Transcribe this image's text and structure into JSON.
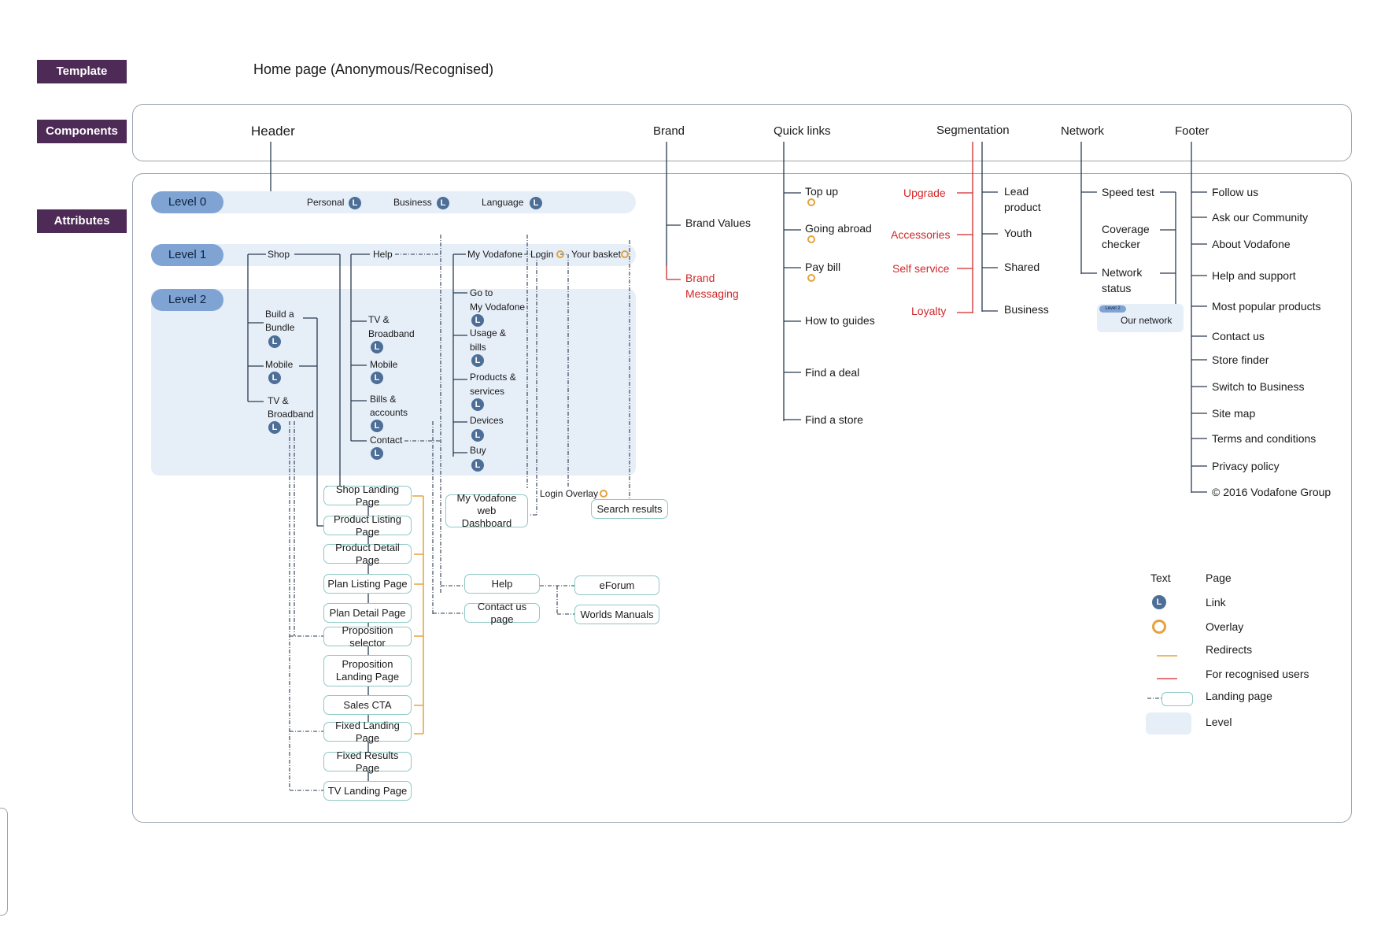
{
  "labels": {
    "template": "Template",
    "components": "Components",
    "attributes": "Attributes"
  },
  "page_title": "Home page (Anonymous/Recognised)",
  "components": {
    "header": "Header",
    "brand": "Brand",
    "quick_links": "Quick links",
    "segmentation": "Segmentation",
    "network": "Network",
    "footer": "Footer"
  },
  "levels": {
    "l0": "Level 0",
    "l1": "Level 1",
    "l2": "Level 2"
  },
  "level0": {
    "personal": "Personal",
    "business": "Business",
    "language": "Language"
  },
  "link_glyph": "L",
  "level1": {
    "shop": "Shop",
    "help": "Help",
    "my_vodafone": "My Vodafone",
    "login": "Login",
    "basket": "Your basket"
  },
  "shop_items": {
    "bundle_a": "Build a",
    "bundle_b": "Bundle",
    "mobile": "Mobile",
    "tv_a": "TV &",
    "tv_b": "Broadband"
  },
  "help_items": {
    "tv_a": "TV &",
    "tv_b": "Broadband",
    "mobile": "Mobile",
    "bills_a": "Bills &",
    "bills_b": "accounts",
    "contact": "Contact"
  },
  "myv_items": {
    "goto_a": "Go to",
    "goto_b": "My Vodafone",
    "usage_a": "Usage &",
    "usage_b": "bills",
    "prod_a": "Products &",
    "prod_b": "services",
    "devices": "Devices",
    "buy": "Buy"
  },
  "pages": {
    "shop_landing": "Shop Landing Page",
    "product_listing": "Product Listing Page",
    "product_detail": "Product Detail Page",
    "plan_listing": "Plan Listing Page",
    "plan_detail": "Plan Detail Page",
    "proposition_selector": "Proposition selector",
    "prop_landing_a": "Proposition",
    "prop_landing_b": "Landing Page",
    "sales_cta": "Sales CTA",
    "fixed_landing": "Fixed Landing Page",
    "fixed_results": "Fixed Results Page",
    "tv_landing": "TV Landing Page",
    "myv_dash_a": "My Vodafone web",
    "myv_dash_b": "Dashboard",
    "login_overlay": "Login Overlay",
    "search_results": "Search results",
    "help": "Help",
    "contact_us": "Contact us page",
    "eforum": "eForum",
    "worlds_manuals": "Worlds Manuals"
  },
  "brand": {
    "values": "Brand Values",
    "messaging_a": "Brand",
    "messaging_b": "Messaging"
  },
  "quick": {
    "top_up": "Top up",
    "going_abroad": "Going abroad",
    "pay_bill": "Pay bill",
    "how_to": "How to guides",
    "find_deal": "Find a deal",
    "find_store": "Find a store"
  },
  "segmentation": {
    "upgrade": "Upgrade",
    "accessories": "Accessories",
    "self_service": "Self service",
    "loyalty": "Loyalty",
    "lead_a": "Lead",
    "lead_b": "product",
    "youth": "Youth",
    "shared": "Shared",
    "business": "Business"
  },
  "network": {
    "speed_test": "Speed test",
    "coverage_a": "Coverage",
    "coverage_b": "checker",
    "status_a": "Network",
    "status_b": "status",
    "our_network": "Our network",
    "level2_tag": "Level 2"
  },
  "footer": {
    "items": [
      "Follow us",
      "Ask our Community",
      "About Vodafone",
      "Help and support",
      "Most popular products",
      "Contact us",
      "Store finder",
      "Switch to Business",
      "Site map",
      "Terms and conditions",
      "Privacy policy",
      "© 2016 Vodafone Group"
    ]
  },
  "legend": {
    "text_h": "Text",
    "page_h": "Page",
    "link": "Link",
    "overlay": "Overlay",
    "redirects": "Redirects",
    "recognised": "For recognised users",
    "landing": "Landing page",
    "level": "Level"
  },
  "colors": {
    "plum": "#4e2a56",
    "level_pill": "#7fa4d4",
    "level_band": "#e6eef8",
    "link_badge": "#4d6f97",
    "overlay": "#e6a23c",
    "red": "#d0282a",
    "page_border": "#8ec9c4"
  }
}
